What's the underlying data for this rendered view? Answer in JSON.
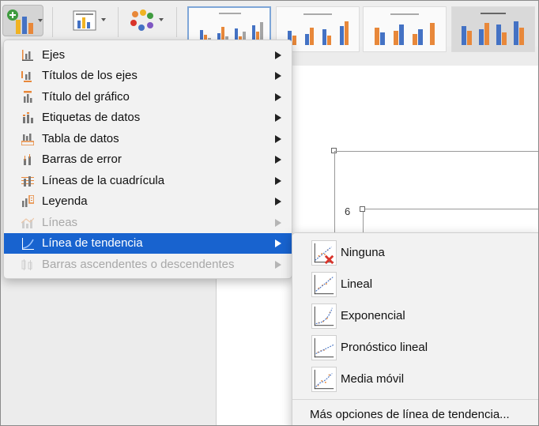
{
  "menu": {
    "items": [
      {
        "label": "Ejes",
        "icon": "axes-icon"
      },
      {
        "label": "Títulos de los ejes",
        "icon": "axis-titles-icon"
      },
      {
        "label": "Título del gráfico",
        "icon": "chart-title-icon"
      },
      {
        "label": "Etiquetas de datos",
        "icon": "data-labels-icon"
      },
      {
        "label": "Tabla de datos",
        "icon": "data-table-icon"
      },
      {
        "label": "Barras de error",
        "icon": "error-bars-icon"
      },
      {
        "label": "Líneas de la cuadrícula",
        "icon": "gridlines-icon"
      },
      {
        "label": "Leyenda",
        "icon": "legend-icon"
      },
      {
        "label": "Líneas",
        "icon": "lines-icon",
        "disabled": true
      },
      {
        "label": "Línea de tendencia",
        "icon": "trendline-icon",
        "highlighted": true
      },
      {
        "label": "Barras ascendentes o descendentes",
        "icon": "up-down-bars-icon",
        "disabled": true
      }
    ]
  },
  "submenu": {
    "items": [
      {
        "label": "Ninguna",
        "icon": "trendline-none-icon"
      },
      {
        "label": "Lineal",
        "icon": "trendline-linear-icon"
      },
      {
        "label": "Exponencial",
        "icon": "trendline-exponential-icon"
      },
      {
        "label": "Pronóstico lineal",
        "icon": "trendline-forecast-icon"
      },
      {
        "label": "Media móvil",
        "icon": "trendline-moving-average-icon"
      }
    ],
    "more": "Más opciones de línea de tendencia..."
  },
  "chart": {
    "axis_value": "6"
  },
  "colors": {
    "highlight": "#1863cf",
    "orange": "#e8883a",
    "blue": "#4472c4",
    "gray": "#a5a5a5",
    "red": "#d9342b"
  }
}
